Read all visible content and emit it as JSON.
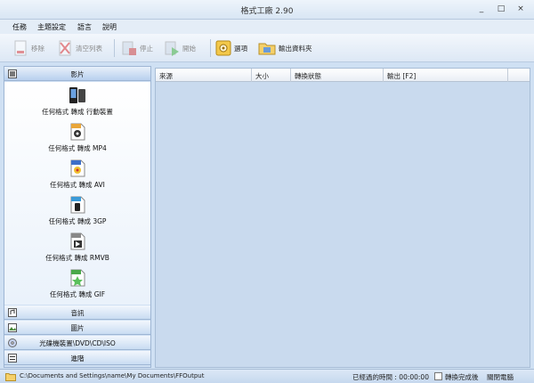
{
  "window": {
    "title": "格式工廠 2.90",
    "controls": [
      "_",
      "□",
      "×"
    ]
  },
  "menu": [
    "任務",
    "主題設定",
    "語言",
    "說明"
  ],
  "toolbar": {
    "remove": "移除",
    "clear": "清空列表",
    "stop": "停止",
    "start": "開始",
    "options": "選項",
    "output_folder": "輸出資料夾"
  },
  "sidebar": {
    "video_category": "影片",
    "items": [
      {
        "label": "任何格式 轉成 行動裝置",
        "badge": ""
      },
      {
        "label": "任何格式 轉成 MP4",
        "badge": "MP4"
      },
      {
        "label": "任何格式 轉成 AVI",
        "badge": "AVI"
      },
      {
        "label": "任何格式 轉成 3GP",
        "badge": "3GP"
      },
      {
        "label": "任何格式 轉成 RMVB",
        "badge": "RMVB"
      },
      {
        "label": "任何格式 轉成 GIF",
        "badge": "GIF"
      }
    ],
    "categories": [
      "音訊",
      "圖片",
      "光碟機裝置\\DVD\\CD\\ISO",
      "進階"
    ]
  },
  "table": {
    "columns": [
      "來源",
      "大小",
      "轉換狀態",
      "輸出 [F2]"
    ]
  },
  "statusbar": {
    "path": "C:\\Documents and Settings\\name\\My Documents\\FFOutput",
    "elapsed": "已經過的時間 : 00:00:00",
    "after_label": "轉換完成後",
    "shutdown": "關閉電腦"
  },
  "colors": {
    "accent": "#4a86c8",
    "panel": "#cfe0f3"
  }
}
